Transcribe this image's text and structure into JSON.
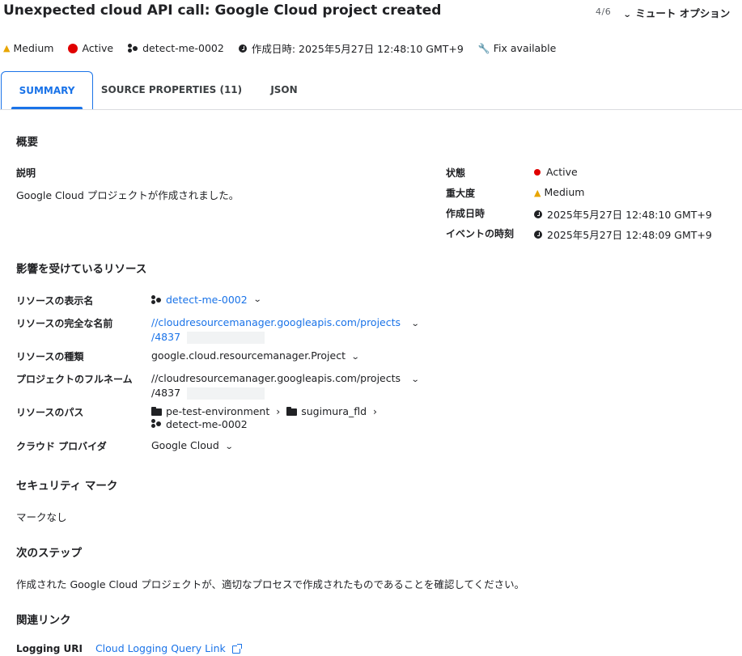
{
  "header": {
    "title": "Unexpected cloud API call: Google Cloud project created",
    "pager": "4/6",
    "mute_label": "ミュート オプション"
  },
  "status_bar": {
    "severity": "Medium",
    "state": "Active",
    "project": "detect-me-0002",
    "created": "作成日時: 2025年5月27日 12:48:10 GMT+9",
    "fix": "Fix available"
  },
  "tabs": [
    {
      "label": "SUMMARY"
    },
    {
      "label": "SOURCE PROPERTIES (11)"
    },
    {
      "label": "JSON"
    }
  ],
  "overview": {
    "heading": "概要",
    "desc_label": "説明",
    "desc_text": "Google Cloud プロジェクトが作成されました。",
    "state_label": "状態",
    "state_value": "Active",
    "severity_label": "重大度",
    "severity_value": "Medium",
    "created_label": "作成日時",
    "created_value": "2025年5月27日 12:48:10 GMT+9",
    "event_label": "イベントの時刻",
    "event_value": "2025年5月27日 12:48:09 GMT+9"
  },
  "resources": {
    "heading": "影響を受けているリソース",
    "display_name_label": "リソースの表示名",
    "display_name_value": "detect-me-0002",
    "full_name_label": "リソースの完全な名前",
    "full_name_line1": "//cloudresourcemanager.googleapis.com/projects",
    "full_name_line2": "/4837",
    "type_label": "リソースの種類",
    "type_value": "google.cloud.resourcemanager.Project",
    "project_full_label": "プロジェクトのフルネーム",
    "project_full_line1": "//cloudresourcemanager.googleapis.com/projects",
    "project_full_line2": "/4837",
    "path_label": "リソースのパス",
    "path_folder1": "pe-test-environment",
    "path_folder2": "sugimura_fld",
    "path_project": "detect-me-0002",
    "provider_label": "クラウド プロバイダ",
    "provider_value": "Google Cloud"
  },
  "security_marks": {
    "heading": "セキュリティ マーク",
    "text": "マークなし"
  },
  "next_steps": {
    "heading": "次のステップ",
    "text": "作成された Google Cloud プロジェクトが、適切なプロセスで作成されたものであることを確認してください。"
  },
  "related_links": {
    "heading": "関連リンク",
    "logging_label": "Logging URI",
    "logging_link": "Cloud Logging Query Link"
  }
}
